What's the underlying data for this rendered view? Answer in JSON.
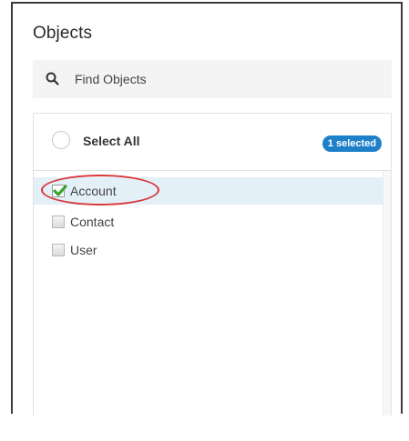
{
  "panel": {
    "title": "Objects"
  },
  "search": {
    "icon": "search-icon",
    "placeholder": "Find Objects"
  },
  "select_all": {
    "label": "Select All",
    "badge": "1 selected"
  },
  "objects": [
    {
      "label": "Account",
      "checked": true
    },
    {
      "label": "Contact",
      "checked": false
    },
    {
      "label": "User",
      "checked": false
    }
  ],
  "colors": {
    "accent": "#1e80c9",
    "selected_row": "#e3f0f8",
    "checkmark": "#3aa336",
    "annotation": "#d9373a"
  }
}
